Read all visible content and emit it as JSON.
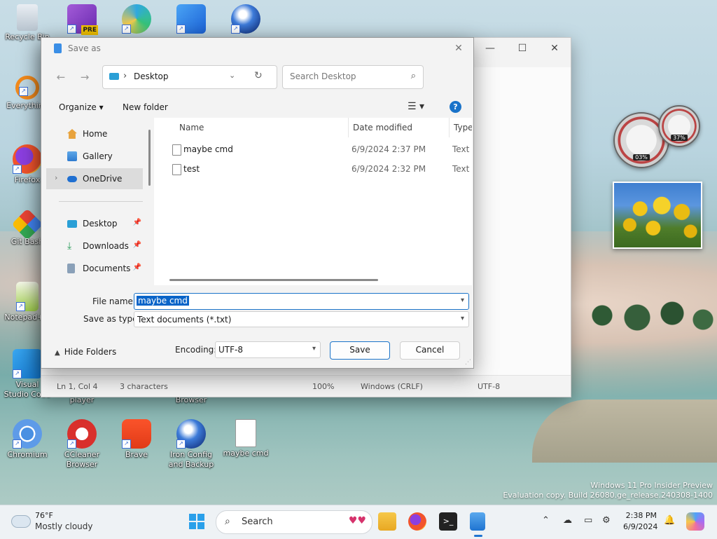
{
  "desktop": {
    "icons": [
      {
        "label": "Recycle Bin",
        "name": "recycle-bin"
      },
      {
        "label": "",
        "name": "visual-studio-preview"
      },
      {
        "label": "",
        "name": "edge"
      },
      {
        "label": "",
        "name": "word-app"
      },
      {
        "label": "",
        "name": "globe-app"
      },
      {
        "label": "Everything",
        "name": "everything"
      },
      {
        "label": "Firefox",
        "name": "firefox"
      },
      {
        "label": "Git Bash",
        "name": "git-bash"
      },
      {
        "label": "Notepad++",
        "name": "notepad-plus-plus"
      },
      {
        "label": "Visual Studio Code",
        "name": "vscode"
      },
      {
        "label": "player",
        "name": "player"
      },
      {
        "label": "Browser",
        "name": "browser"
      },
      {
        "label": "Chromium",
        "name": "chromium"
      },
      {
        "label": "CCleaner Browser",
        "name": "ccleaner-browser"
      },
      {
        "label": "Brave",
        "name": "brave"
      },
      {
        "label": "Iron Config and Backup",
        "name": "iron-config"
      },
      {
        "label": "maybe cmd",
        "name": "maybe-cmd-file"
      }
    ],
    "gadgets": {
      "cpu_percent": "03%",
      "ram_percent": "37%"
    },
    "watermark": {
      "line1": "Windows 11 Pro Insider Preview",
      "line2": "Evaluation copy. Build 26080.ge_release.240308-1400"
    }
  },
  "notepad": {
    "status": {
      "position": "Ln 1, Col 4",
      "chars": "3 characters",
      "zoom": "100%",
      "line_ending": "Windows (CRLF)",
      "encoding": "UTF-8"
    }
  },
  "dialog": {
    "title": "Save as",
    "address": {
      "location": "Desktop"
    },
    "search_placeholder": "Search Desktop",
    "commands": {
      "organize": "Organize ▾",
      "new_folder": "New folder"
    },
    "nav": [
      {
        "label": "Home",
        "pinned": false
      },
      {
        "label": "Gallery",
        "pinned": false
      },
      {
        "label": "OneDrive",
        "pinned": false,
        "selected": true
      },
      {
        "label": "Desktop",
        "pinned": true
      },
      {
        "label": "Downloads",
        "pinned": true
      },
      {
        "label": "Documents",
        "pinned": true
      }
    ],
    "columns": {
      "name": "Name",
      "date": "Date modified",
      "type": "Type"
    },
    "files": [
      {
        "name": "maybe cmd",
        "date": "6/9/2024 2:37 PM",
        "type": "Text D"
      },
      {
        "name": "test",
        "date": "6/9/2024 2:32 PM",
        "type": "Text D"
      }
    ],
    "file_name_label": "File name:",
    "file_name": "maybe cmd",
    "save_type_label": "Save as type:",
    "save_type": "Text documents (*.txt)",
    "hide_folders": "Hide Folders",
    "encoding_label": "Encoding:",
    "encoding": "UTF-8",
    "save": "Save",
    "cancel": "Cancel"
  },
  "taskbar": {
    "weather_temp": "76°F",
    "weather_desc": "Mostly cloudy",
    "search": "Search",
    "time": "2:38 PM",
    "date": "6/9/2024"
  }
}
